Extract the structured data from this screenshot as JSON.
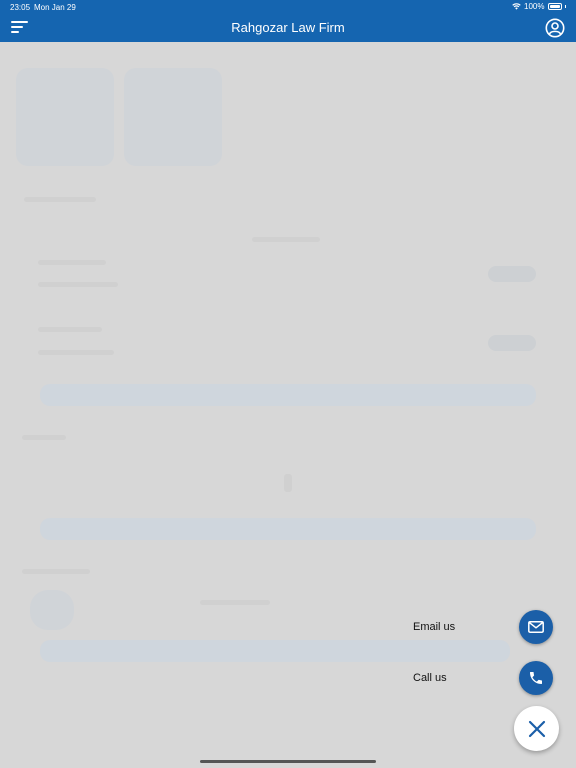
{
  "status_bar": {
    "time": "23:05",
    "date": "Mon Jan 29",
    "battery": "100%"
  },
  "header": {
    "title": "Rahgozar Law Firm"
  },
  "contact_menu": {
    "email_label": "Email us",
    "call_label": "Call us"
  },
  "colors": {
    "primary": "#1565b0",
    "fab": "#1b5fa8",
    "overlay": "#d7d7d7"
  }
}
